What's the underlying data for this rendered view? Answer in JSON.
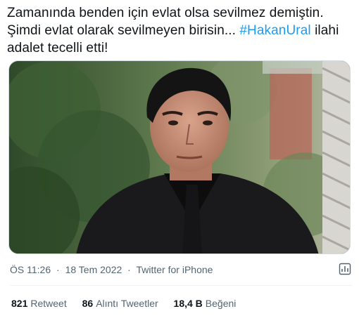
{
  "tweet": {
    "line1": "Zamanında benden için evlat olsa sevilmez demiştin.",
    "line2_text": "Şimdi evlat olarak sevilmeyen birisin... ",
    "hashtag": "#HakanUral",
    "line2_tail": " ilahi",
    "line3": "adalet tecelli etti!"
  },
  "meta": {
    "time": "ÖS 11:26",
    "date": "18 Tem 2022",
    "source": "Twitter for iPhone"
  },
  "stats": {
    "retweets_count": "821",
    "retweets_label": "Retweet",
    "quotes_count": "86",
    "quotes_label": "Alıntı Tweetler",
    "likes_count": "18,4 B",
    "likes_label": "Beğeni"
  },
  "colors": {
    "accent": "#1d9bf0",
    "text": "#0f1419",
    "secondary": "#536471"
  },
  "icons": {
    "analytics": "analytics-icon"
  }
}
